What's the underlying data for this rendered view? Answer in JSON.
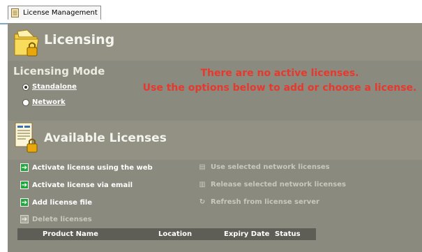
{
  "tab": {
    "title": "License Management"
  },
  "licensing": {
    "title": "Licensing",
    "mode_title": "Licensing Mode",
    "modes": [
      {
        "label": "Standalone",
        "selected": true
      },
      {
        "label": "Network",
        "selected": false
      }
    ],
    "message_line1": "There are no active licenses.",
    "message_line2": "Use the options below to add or choose a license."
  },
  "available": {
    "title": "Available Licenses",
    "actions_left": [
      {
        "label": "Activate license using the web",
        "enabled": true
      },
      {
        "label": "Activate license via email",
        "enabled": true
      },
      {
        "label": "Add license file",
        "enabled": true
      },
      {
        "label": "Delete licenses",
        "enabled": false
      }
    ],
    "actions_right": [
      {
        "label": "Use selected network licenses",
        "enabled": false,
        "icon": "network-license-icon"
      },
      {
        "label": "Release selected network licenses",
        "enabled": false,
        "icon": "release-license-icon"
      },
      {
        "label": "Refresh from license server",
        "enabled": false,
        "icon": "refresh-icon"
      }
    ],
    "columns": [
      "Product Name",
      "Location",
      "Expiry Date",
      "Status"
    ]
  },
  "colors": {
    "panel_background": "#8b8a7f",
    "message_red": "#e8382d",
    "action_green": "#22a63c"
  }
}
